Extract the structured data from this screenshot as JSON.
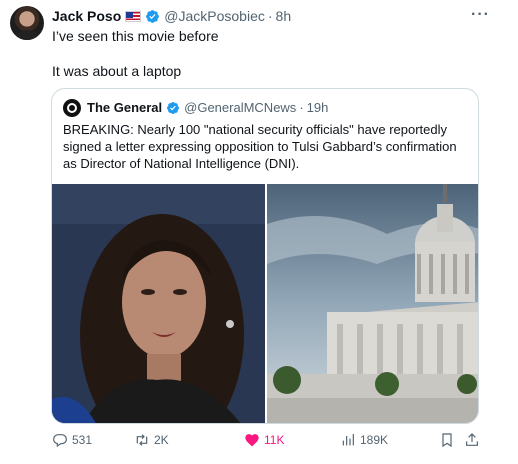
{
  "tweet": {
    "author_name": "Jack Poso",
    "handle": "@JackPosobiec",
    "separator": "·",
    "time": "8h",
    "line1": "I’ve seen this movie before",
    "line2": "It was about a laptop",
    "more": "···"
  },
  "quote": {
    "author_name": "The General",
    "handle": "@GeneralMCNews",
    "separator": "·",
    "time": "19h",
    "text": "BREAKING: Nearly 100 \"national security officials\" have reportedly signed a letter expressing opposition to Tulsi Gabbard’s confirmation as Director of National Intelligence (DNI)."
  },
  "actions": {
    "replies": "531",
    "reposts": "2K",
    "likes": "11K",
    "views": "189K"
  },
  "colors": {
    "verified": "#1d9bf0",
    "like": "#f91880",
    "muted": "#536471",
    "border": "#cfd9de"
  },
  "icons": {
    "verified": "verified-badge-icon",
    "flag": "us-flag-icon",
    "reply": "reply-icon",
    "repost": "repost-icon",
    "like": "heart-icon",
    "views": "views-chart-icon",
    "bookmark": "bookmark-icon",
    "share": "share-icon"
  }
}
